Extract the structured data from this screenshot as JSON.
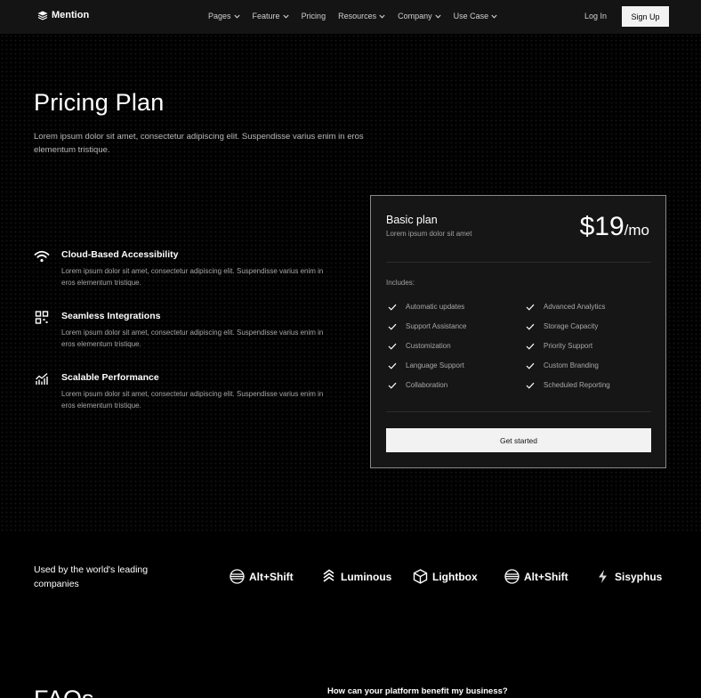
{
  "nav": {
    "logo_text": "Mention",
    "links": [
      {
        "label": "Pages",
        "has_dropdown": true
      },
      {
        "label": "Feature",
        "has_dropdown": true
      },
      {
        "label": "Pricing",
        "has_dropdown": false
      },
      {
        "label": "Resources",
        "has_dropdown": true
      },
      {
        "label": "Company",
        "has_dropdown": true
      },
      {
        "label": "Use Case",
        "has_dropdown": true
      }
    ],
    "login": "Log In",
    "signup": "Sign Up"
  },
  "hero": {
    "title": "Pricing Plan",
    "subtitle": "Lorem ipsum dolor sit amet, consectetur adipiscing elit. Suspendisse varius enim in eros elementum tristique."
  },
  "features": [
    {
      "icon": "wifi-icon",
      "title": "Cloud-Based Accessibility",
      "desc": "Lorem ipsum dolor sit amet, consectetur adipiscing elit. Suspendisse varius enim in eros elementum tristique."
    },
    {
      "icon": "grid-icon",
      "title": "Seamless Integrations",
      "desc": "Lorem ipsum dolor sit amet, consectetur adipiscing elit. Suspendisse varius enim in eros elementum tristique."
    },
    {
      "icon": "chart-icon",
      "title": "Scalable Performance",
      "desc": "Lorem ipsum dolor sit amet, consectetur adipiscing elit. Suspendisse varius enim in eros elementum tristique."
    }
  ],
  "plan": {
    "name": "Basic plan",
    "sub": "Lorem ipsum dolor sit amet",
    "price": "$19",
    "unit": "/mo",
    "includes_label": "Includes:",
    "items_left": [
      "Automatic updates",
      "Support Assistance",
      "Customization",
      "Language Support",
      "Collaboration"
    ],
    "items_right": [
      "Advanced Analytics",
      "Storage Capacity",
      "Priority Support",
      "Custom Branding",
      "Scheduled Reporting"
    ],
    "cta": "Get started"
  },
  "logos": {
    "heading": "Used by the world's leading companies",
    "items": [
      "Alt+Shift",
      "Luminous",
      "Lightbox",
      "Alt+Shift",
      "Sisyphus"
    ]
  },
  "faq": {
    "title": "FAQs",
    "first_question": "How can your platform benefit my business?"
  },
  "colors": {
    "background": "#000000",
    "nav_bg": "#141414",
    "card_bg": "#161616",
    "button_bg": "#f2f2f2"
  }
}
